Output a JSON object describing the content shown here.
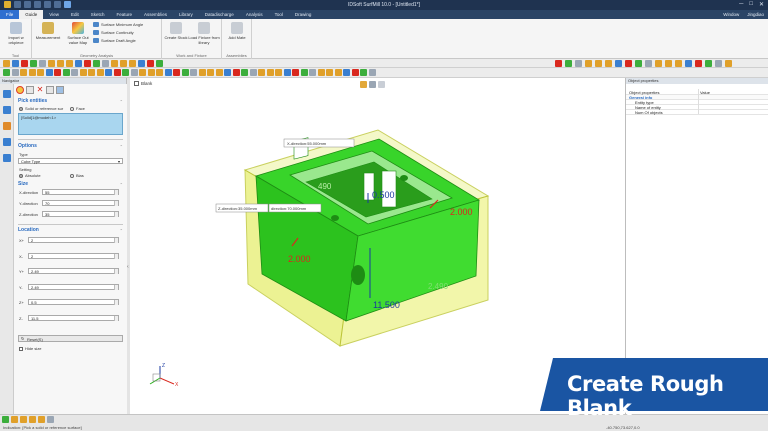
{
  "app": {
    "title": "IDSoft SurfMill 10.0 - [Untitled1*]"
  },
  "window_menu": {
    "window": "Window",
    "user": "Jingdiao"
  },
  "menu": {
    "tabs": [
      "File",
      "Guide",
      "View",
      "Edit",
      "Sketch",
      "Feature",
      "Assemblies",
      "Library",
      "Datadischarge",
      "Analysis",
      "Tool",
      "Drawing"
    ],
    "active": "Guide"
  },
  "ribbon": {
    "groups": [
      "Tool",
      "Geometry Analysis",
      "Work and Fixture",
      "Assemblies"
    ],
    "import_label": "Import w orkpiece",
    "measurement_label": "Measurement",
    "surface_uv_label": "Surface Out value Map",
    "surface_items": [
      "Surface Minimum Angle",
      "Surface Continuity",
      "Surface Draft Angle"
    ],
    "create_stock_label": "Create Stock",
    "load_fixture_label": "Load Fixture from library",
    "add_mate_label": "Add Mate"
  },
  "navigator": {
    "title": "Navigator",
    "pick_title": "Pick entities",
    "pick_opt1": "Solid or reference sur",
    "pick_opt2": "Face",
    "selected_item": "[Solid]1@model<1>",
    "options_title": "Options",
    "type_label": "Type",
    "type_value": "Cube Type",
    "setting_label": "Setting",
    "setting_opt1": "Absolute",
    "setting_opt2": "Bias",
    "size_title": "Size",
    "size_fields": [
      {
        "label": "X-direction",
        "value": "55"
      },
      {
        "label": "Y-direction",
        "value": "70"
      },
      {
        "label": "Z-direction",
        "value": "35"
      }
    ],
    "location_title": "Location",
    "location_fields": [
      {
        "label": "X+",
        "value": "2"
      },
      {
        "label": "X-",
        "value": "2"
      },
      {
        "label": "Y+",
        "value": "2.49"
      },
      {
        "label": "Y-",
        "value": "2.49"
      },
      {
        "label": "Z+",
        "value": "0.5"
      },
      {
        "label": "Z-",
        "value": "11.5"
      }
    ],
    "reset_label": "Reset(S)",
    "hide_label": "Hide size"
  },
  "viewport": {
    "tab": "Blank",
    "annotations": {
      "x_dir": "X-direction:55.000mm",
      "z_dir": "Z-direction:35.000mm",
      "y_dir": "direction:70.000mm",
      "d_center": "0.500",
      "d_right": "2.000",
      "d_left": "2.000",
      "d_bottom": "11.500",
      "d_green1": "490",
      "d_green2": "2.490"
    },
    "colors": {
      "part": "#33dd22",
      "blank": "#e8f07a",
      "outline": "#b8c12a",
      "red": "#d9281e",
      "blue": "#1a3aa0"
    }
  },
  "properties": {
    "title": "Object properties",
    "head_key": "Object properties",
    "head_value": "Value",
    "group": "General info",
    "rows": [
      "Entity type",
      "Name of entity",
      "Num Of objects"
    ]
  },
  "status": {
    "message": "Indication: [Pick a solid or reference surface]",
    "coords": "-40.750,73.627,0.0"
  },
  "overlay": {
    "text": "Create Rough Blank"
  }
}
